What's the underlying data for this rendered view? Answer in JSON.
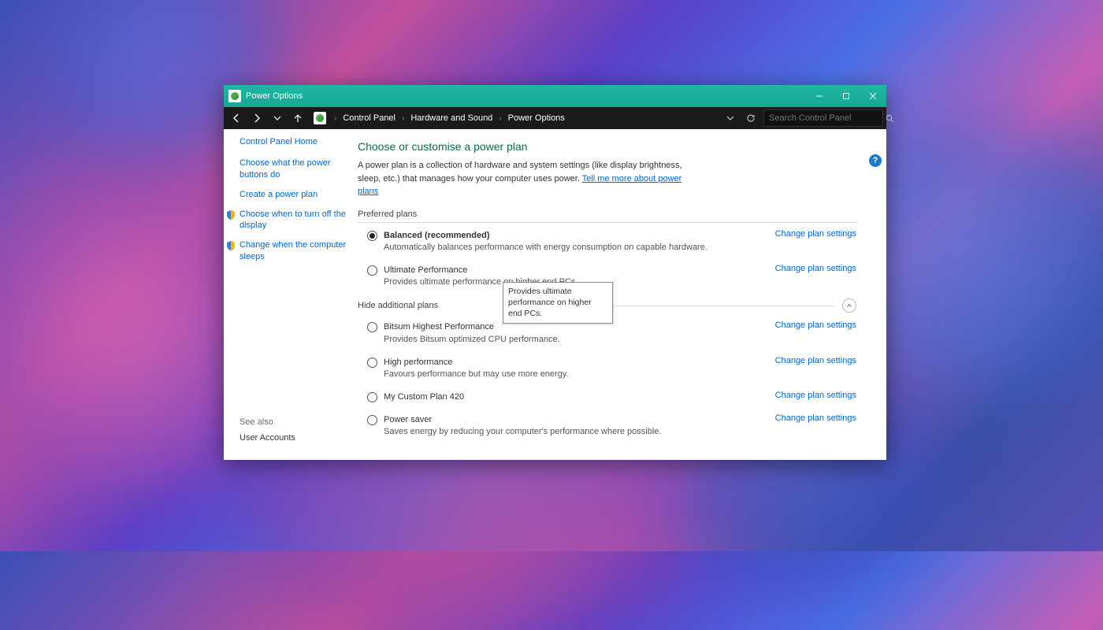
{
  "window": {
    "title": "Power Options"
  },
  "nav": {
    "breadcrumbs": [
      "Control Panel",
      "Hardware and Sound",
      "Power Options"
    ],
    "search_placeholder": "Search Control Panel"
  },
  "sidebar": {
    "home": "Control Panel Home",
    "tasks": [
      "Choose what the power buttons do",
      "Create a power plan",
      "Choose when to turn off the display",
      "Change when the computer sleeps"
    ],
    "see_also_label": "See also",
    "see_also_link": "User Accounts"
  },
  "content": {
    "heading": "Choose or customise a power plan",
    "intro": "A power plan is a collection of hardware and system settings (like display brightness, sleep, etc.) that manages how your computer uses power. ",
    "intro_link": "Tell me more about power plans",
    "preferred_label": "Preferred plans",
    "additional_label": "Hide additional plans",
    "settings_link": "Change plan settings",
    "plans_preferred": [
      {
        "name": "Balanced (recommended)",
        "desc": "Automatically balances performance with energy consumption on capable hardware.",
        "selected": true,
        "bold": true
      },
      {
        "name": "Ultimate Performance",
        "desc": "Provides ultimate performance on higher end PCs.",
        "selected": false,
        "bold": false
      }
    ],
    "plans_additional": [
      {
        "name": "Bitsum Highest Performance",
        "desc": "Provides Bitsum optimized CPU performance.",
        "selected": false
      },
      {
        "name": "High performance",
        "desc": "Favours performance but may use more energy.",
        "selected": false
      },
      {
        "name": "My Custom Plan 420",
        "desc": "",
        "selected": false
      },
      {
        "name": "Power saver",
        "desc": "Saves energy by reducing your computer's performance where possible.",
        "selected": false
      }
    ],
    "tooltip": "Provides ultimate performance on higher end PCs."
  },
  "help_icon": "?"
}
